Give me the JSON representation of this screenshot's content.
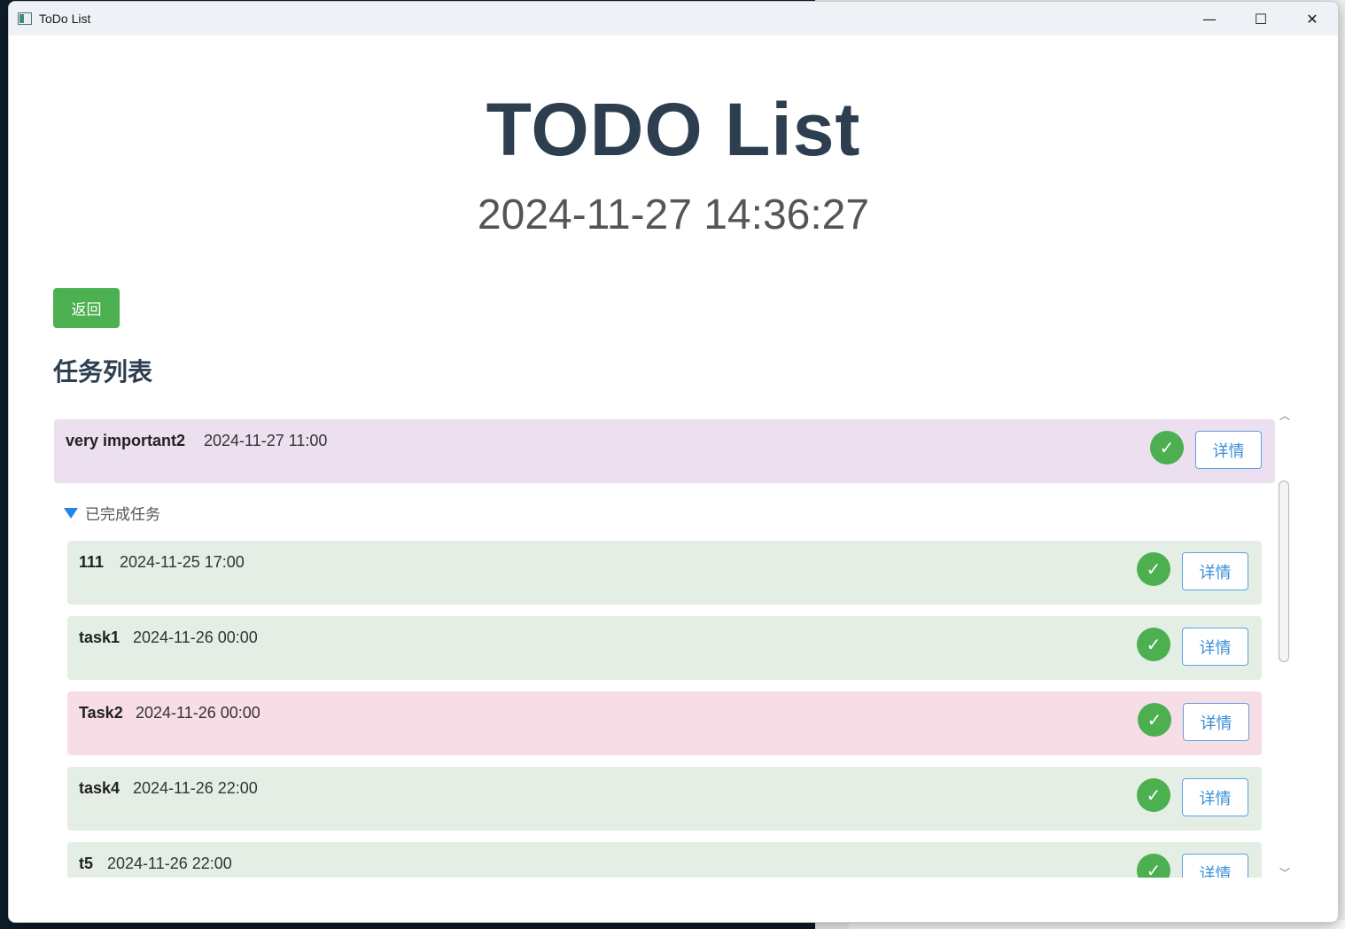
{
  "window": {
    "title": "ToDo List",
    "controls": {
      "minimize": "—",
      "maximize": "☐",
      "close": "✕"
    }
  },
  "header": {
    "title": "TODO List",
    "clock": "2024-11-27 14:36:27"
  },
  "back_button": "返回",
  "section_title": "任务列表",
  "active_tasks": [
    {
      "name": "very important2",
      "time": "2024-11-27 11:00",
      "status": "important"
    }
  ],
  "completed_group": {
    "label": "已完成任务",
    "expanded": true,
    "tasks": [
      {
        "name": "111",
        "time": "2024-11-25 17:00",
        "status": "done"
      },
      {
        "name": "task1",
        "time": "2024-11-26 00:00",
        "status": "done"
      },
      {
        "name": "Task2",
        "time": "2024-11-26 00:00",
        "status": "overdue"
      },
      {
        "name": "task4",
        "time": "2024-11-26 22:00",
        "status": "done"
      },
      {
        "name": "t5",
        "time": "2024-11-26 22:00",
        "status": "done"
      }
    ]
  },
  "actions": {
    "complete_icon": "✓",
    "detail_label": "详情"
  },
  "colors": {
    "accent_green": "#4caf50",
    "title_color": "#2c3e50",
    "detail_blue": "#3a8fd8",
    "important_bg": "#ecdff0",
    "done_bg": "#e4eee5",
    "overdue_bg": "#f7dde6"
  }
}
